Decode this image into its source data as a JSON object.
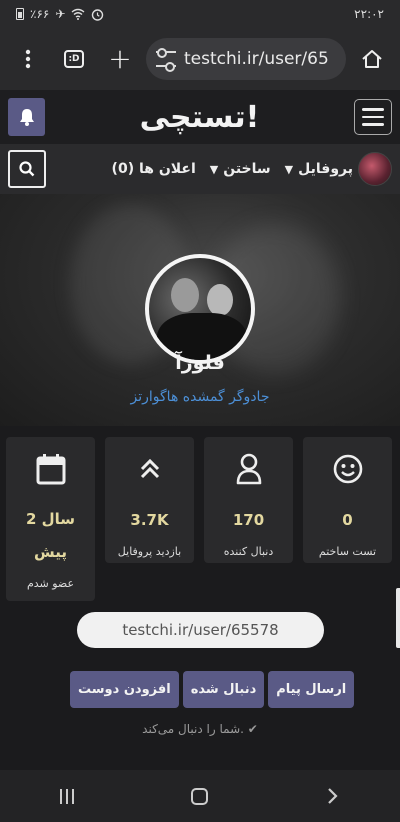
{
  "status_bar": {
    "time": "۲۲:۰۲",
    "battery": "٪۶۶"
  },
  "browser": {
    "url": "testchi.ir/user/65",
    "tabs_label": ":D"
  },
  "header": {
    "logo": "تستچی!"
  },
  "nav": {
    "profile_label": "پروفایل",
    "create_label": "ساختن",
    "notifications_label": "اعلان ها (0)"
  },
  "profile": {
    "name": "فلورآ",
    "tagline": "جادوگر گمشده هاگوارتز"
  },
  "stats": [
    {
      "value": "2 سال پیش",
      "label": "عضو شدم",
      "icon": "calendar-icon"
    },
    {
      "value": "3.7K",
      "label": "بازدید پروفایل",
      "icon": "chevrons-up-icon"
    },
    {
      "value": "170",
      "label": "دنبال کننده",
      "icon": "user-icon"
    },
    {
      "value": "0",
      "label": "تست ساختم",
      "icon": "smile-icon"
    }
  ],
  "profile_url": "testchi.ir/user/65578",
  "actions": {
    "add_friend": "افزودن دوست",
    "followed": "دنبال شده",
    "send_message": "ارسال پیام"
  },
  "follows_you": "شما را دنبال می‌کند.",
  "colors": {
    "accent": "#5a5a86",
    "link": "#4c8fd6",
    "stat_value": "#e3d8a0",
    "background": "#1b1b1d"
  }
}
